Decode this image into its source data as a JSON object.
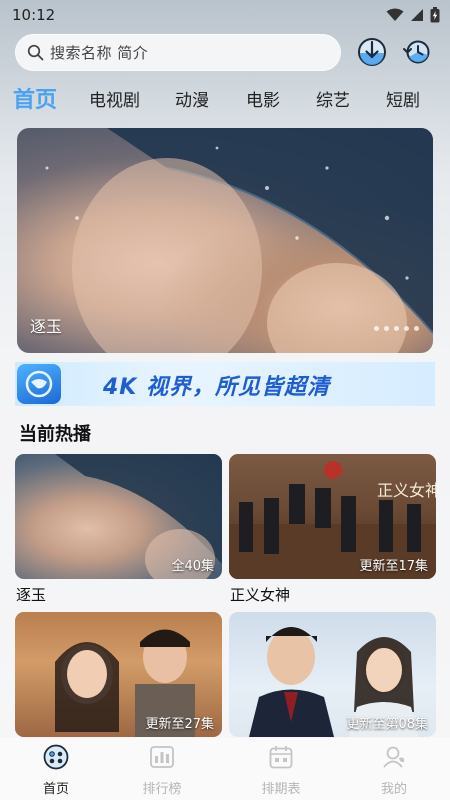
{
  "status": {
    "time": "10:12"
  },
  "search": {
    "placeholder": "搜索名称 简介"
  },
  "tabs": [
    {
      "label": "首页",
      "active": true
    },
    {
      "label": "电视剧"
    },
    {
      "label": "动漫"
    },
    {
      "label": "电影"
    },
    {
      "label": "综艺"
    },
    {
      "label": "短剧"
    }
  ],
  "hero": {
    "title": "逐玉",
    "slide_count": 5
  },
  "banner": {
    "text": "4K 视界，所见皆超清"
  },
  "section": {
    "title": "当前热播"
  },
  "cards": [
    {
      "title": "逐玉",
      "episode": "全40集"
    },
    {
      "title": "正义女神",
      "episode": "更新至17集"
    },
    {
      "title": "",
      "episode": "更新至27集"
    },
    {
      "title": "",
      "episode": "更新至第08集"
    }
  ],
  "nav": [
    {
      "label": "首页",
      "icon": "home-icon",
      "active": true
    },
    {
      "label": "排行榜",
      "icon": "ranking-icon"
    },
    {
      "label": "排期表",
      "icon": "calendar-icon"
    },
    {
      "label": "我的",
      "icon": "profile-icon"
    }
  ],
  "colors": {
    "accent": "#4aa3ef",
    "banner_text": "#1f5ed0"
  }
}
